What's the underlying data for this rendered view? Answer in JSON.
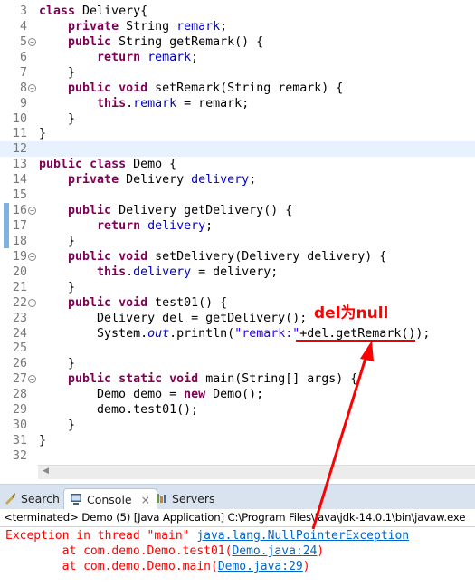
{
  "editor": {
    "lines": [
      {
        "n": "3",
        "fold": false,
        "tokens": [
          [
            "kw",
            "class"
          ],
          [
            "tx",
            " Delivery{"
          ]
        ]
      },
      {
        "n": "4",
        "fold": false,
        "tokens": [
          [
            "tx",
            "    "
          ],
          [
            "kw",
            "private"
          ],
          [
            "tx",
            " String "
          ],
          [
            "fd",
            "remark"
          ],
          [
            "tx",
            ";"
          ]
        ]
      },
      {
        "n": "5",
        "fold": true,
        "tokens": [
          [
            "tx",
            "    "
          ],
          [
            "kw",
            "public"
          ],
          [
            "tx",
            " String getRemark() {"
          ]
        ]
      },
      {
        "n": "6",
        "fold": false,
        "tokens": [
          [
            "tx",
            "        "
          ],
          [
            "kw",
            "return"
          ],
          [
            "tx",
            " "
          ],
          [
            "fd",
            "remark"
          ],
          [
            "tx",
            ";"
          ]
        ]
      },
      {
        "n": "7",
        "fold": false,
        "tokens": [
          [
            "tx",
            "    }"
          ]
        ]
      },
      {
        "n": "8",
        "fold": true,
        "tokens": [
          [
            "tx",
            "    "
          ],
          [
            "kw",
            "public"
          ],
          [
            "tx",
            " "
          ],
          [
            "kw",
            "void"
          ],
          [
            "tx",
            " setRemark(String remark) {"
          ]
        ]
      },
      {
        "n": "9",
        "fold": false,
        "tokens": [
          [
            "tx",
            "        "
          ],
          [
            "kw",
            "this"
          ],
          [
            "tx",
            "."
          ],
          [
            "fd",
            "remark"
          ],
          [
            "tx",
            " = remark;"
          ]
        ]
      },
      {
        "n": "10",
        "fold": false,
        "tokens": [
          [
            "tx",
            "    }"
          ]
        ]
      },
      {
        "n": "11",
        "fold": false,
        "tokens": [
          [
            "tx",
            "}"
          ]
        ]
      },
      {
        "n": "12",
        "fold": false,
        "highlight": true,
        "tokens": []
      },
      {
        "n": "13",
        "fold": false,
        "tokens": [
          [
            "kw",
            "public"
          ],
          [
            "tx",
            " "
          ],
          [
            "kw",
            "class"
          ],
          [
            "tx",
            " Demo {"
          ]
        ]
      },
      {
        "n": "14",
        "fold": false,
        "tokens": [
          [
            "tx",
            "    "
          ],
          [
            "kw",
            "private"
          ],
          [
            "tx",
            " Delivery "
          ],
          [
            "fd",
            "delivery"
          ],
          [
            "tx",
            ";"
          ]
        ]
      },
      {
        "n": "15",
        "fold": false,
        "tokens": []
      },
      {
        "n": "16",
        "fold": true,
        "tokens": [
          [
            "tx",
            "    "
          ],
          [
            "kw",
            "public"
          ],
          [
            "tx",
            " Delivery getDelivery() {"
          ]
        ]
      },
      {
        "n": "17",
        "fold": false,
        "tokens": [
          [
            "tx",
            "        "
          ],
          [
            "kw",
            "return"
          ],
          [
            "tx",
            " "
          ],
          [
            "fd",
            "delivery"
          ],
          [
            "tx",
            ";"
          ]
        ]
      },
      {
        "n": "18",
        "fold": false,
        "tokens": [
          [
            "tx",
            "    }"
          ]
        ]
      },
      {
        "n": "19",
        "fold": true,
        "tokens": [
          [
            "tx",
            "    "
          ],
          [
            "kw",
            "public"
          ],
          [
            "tx",
            " "
          ],
          [
            "kw",
            "void"
          ],
          [
            "tx",
            " setDelivery(Delivery delivery) {"
          ]
        ]
      },
      {
        "n": "20",
        "fold": false,
        "tokens": [
          [
            "tx",
            "        "
          ],
          [
            "kw",
            "this"
          ],
          [
            "tx",
            "."
          ],
          [
            "fd",
            "delivery"
          ],
          [
            "tx",
            " = delivery;"
          ]
        ]
      },
      {
        "n": "21",
        "fold": false,
        "tokens": [
          [
            "tx",
            "    }"
          ]
        ]
      },
      {
        "n": "22",
        "fold": true,
        "tokens": [
          [
            "tx",
            "    "
          ],
          [
            "kw",
            "public"
          ],
          [
            "tx",
            " "
          ],
          [
            "kw",
            "void"
          ],
          [
            "tx",
            " test01() {"
          ]
        ]
      },
      {
        "n": "23",
        "fold": false,
        "tokens": [
          [
            "tx",
            "        Delivery del = getDelivery();"
          ]
        ]
      },
      {
        "n": "24",
        "fold": false,
        "tokens": [
          [
            "tx",
            "        System."
          ],
          [
            "it",
            "out"
          ],
          [
            "tx",
            ".println("
          ],
          [
            "st",
            "\"remark:\""
          ],
          [
            "tx",
            "+del.getRemark());"
          ]
        ]
      },
      {
        "n": "25",
        "fold": false,
        "tokens": []
      },
      {
        "n": "26",
        "fold": false,
        "tokens": [
          [
            "tx",
            "    }"
          ]
        ]
      },
      {
        "n": "27",
        "fold": true,
        "tokens": [
          [
            "tx",
            "    "
          ],
          [
            "kw",
            "public"
          ],
          [
            "tx",
            " "
          ],
          [
            "kw",
            "static"
          ],
          [
            "tx",
            " "
          ],
          [
            "kw",
            "void"
          ],
          [
            "tx",
            " main(String[] args) {"
          ]
        ]
      },
      {
        "n": "28",
        "fold": false,
        "tokens": [
          [
            "tx",
            "        Demo demo = "
          ],
          [
            "kw",
            "new"
          ],
          [
            "tx",
            " Demo();"
          ]
        ]
      },
      {
        "n": "29",
        "fold": false,
        "tokens": [
          [
            "tx",
            "        demo.test01();"
          ]
        ]
      },
      {
        "n": "30",
        "fold": false,
        "tokens": [
          [
            "tx",
            "    }"
          ]
        ]
      },
      {
        "n": "31",
        "fold": false,
        "tokens": [
          [
            "tx",
            "}"
          ]
        ]
      },
      {
        "n": "32",
        "fold": false,
        "tokens": []
      }
    ]
  },
  "annotation": {
    "text": "del为null",
    "color": "#ff0000"
  },
  "tabs": [
    {
      "label": "Search",
      "icon": "search-torch-icon",
      "active": false
    },
    {
      "label": "Console",
      "icon": "console-icon",
      "active": true,
      "close": "⨯"
    },
    {
      "label": "Servers",
      "icon": "servers-icon",
      "active": false
    }
  ],
  "console": {
    "status": "<terminated> Demo (5) [Java Application] C:\\Program Files\\Java\\jdk-14.0.1\\bin\\javaw.exe",
    "line1_prefix": "Exception in thread \"main\" ",
    "line1_link": "java.lang.NullPointerException",
    "line2_prefix": "        at com.demo.Demo.test01(",
    "line2_link": "Demo.java:24",
    "line2_suffix": ")",
    "line3_prefix": "        at com.demo.Demo.main(",
    "line3_link": "Demo.java:29",
    "line3_suffix": ")"
  },
  "colors": {
    "keyword": "#7f0055",
    "field": "#0000c0",
    "string": "#2a00ff",
    "error": "#ff0000",
    "link": "#0066cc"
  }
}
